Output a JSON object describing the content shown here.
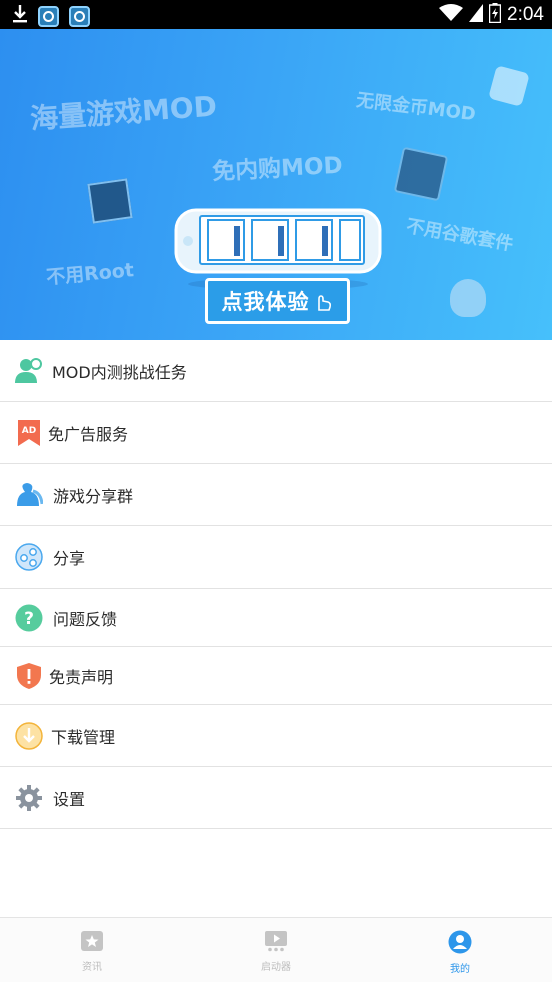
{
  "status_bar": {
    "time": "2:04"
  },
  "banner": {
    "taglines": [
      "海量游戏MOD",
      "免内购MOD",
      "无限金币MOD",
      "不用Root",
      "不用谷歌套件"
    ],
    "cta_label": "点我体验"
  },
  "menu": {
    "items": [
      {
        "label": "MOD内测挑战任务",
        "icon": "user-challenge-icon",
        "color": "#4ec7a0"
      },
      {
        "label": "免广告服务",
        "icon": "ad-ribbon-icon",
        "color": "#f26b4f"
      },
      {
        "label": "游戏分享群",
        "icon": "group-icon",
        "color": "#3b9ce8"
      },
      {
        "label": "分享",
        "icon": "share-icon",
        "color": "#4aa8ee"
      },
      {
        "label": "问题反馈",
        "icon": "question-icon",
        "color": "#56cc9d"
      },
      {
        "label": "免责声明",
        "icon": "shield-alert-icon",
        "color": "#f2774f"
      },
      {
        "label": "下载管理",
        "icon": "download-icon",
        "color": "#f3b43a"
      },
      {
        "label": "设置",
        "icon": "gear-icon",
        "color": "#8a939e"
      }
    ]
  },
  "bottom_nav": {
    "tabs": [
      {
        "label": "资讯",
        "icon": "news-icon",
        "active": false
      },
      {
        "label": "启动器",
        "icon": "launcher-icon",
        "active": false
      },
      {
        "label": "我的",
        "icon": "profile-icon",
        "active": true
      }
    ]
  },
  "colors": {
    "accent": "#2d96ea",
    "banner_start": "#2d8ff0",
    "banner_end": "#46c0fb"
  }
}
